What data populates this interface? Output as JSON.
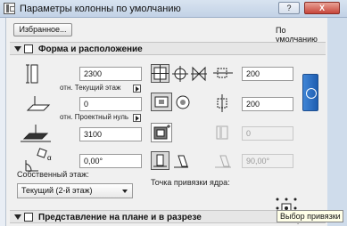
{
  "window": {
    "title": "Параметры колонны по умолчанию",
    "help_label": "?",
    "close_label": "X"
  },
  "toolbar": {
    "favorites_label": "Избранное...",
    "default_label": "По умолчанию"
  },
  "section_form": {
    "title": "Форма и расположение"
  },
  "fields": {
    "height_value": "2300",
    "top_link_label": "отн. Текущий этаж",
    "bottom_offset_value": "0",
    "bottom_link_label": "отн. Проектный нуль",
    "elevation_value": "3100",
    "angle_value": "0,00°",
    "size_x_value": "200",
    "size_y_value": "200",
    "veneer_value": "0",
    "slant_value": "90,00°"
  },
  "home_story": {
    "label": "Собственный этаж:",
    "selected": "Текущий (2-й этаж)"
  },
  "anchor": {
    "label": "Точка привязки ядра:",
    "tooltip": "Выбор привязки"
  },
  "section_plan": {
    "title": "Представление на плане и в разрезе"
  },
  "icons": {
    "app": "column-app-icon",
    "height": "column-height-icon",
    "bottom_offset": "bottom-offset-icon",
    "elevation": "elevation-icon",
    "angle": "rotation-angle-icon",
    "rect_column": "rectangular-column-icon",
    "round_column": "round-column-icon",
    "veneer_core": "core-veneer-icon",
    "slant": "slant-column-icon"
  },
  "colors": {
    "accent": "#2a6cc3",
    "window_bg": "#e9eef5",
    "panel_bg": "#f0f0f0"
  }
}
